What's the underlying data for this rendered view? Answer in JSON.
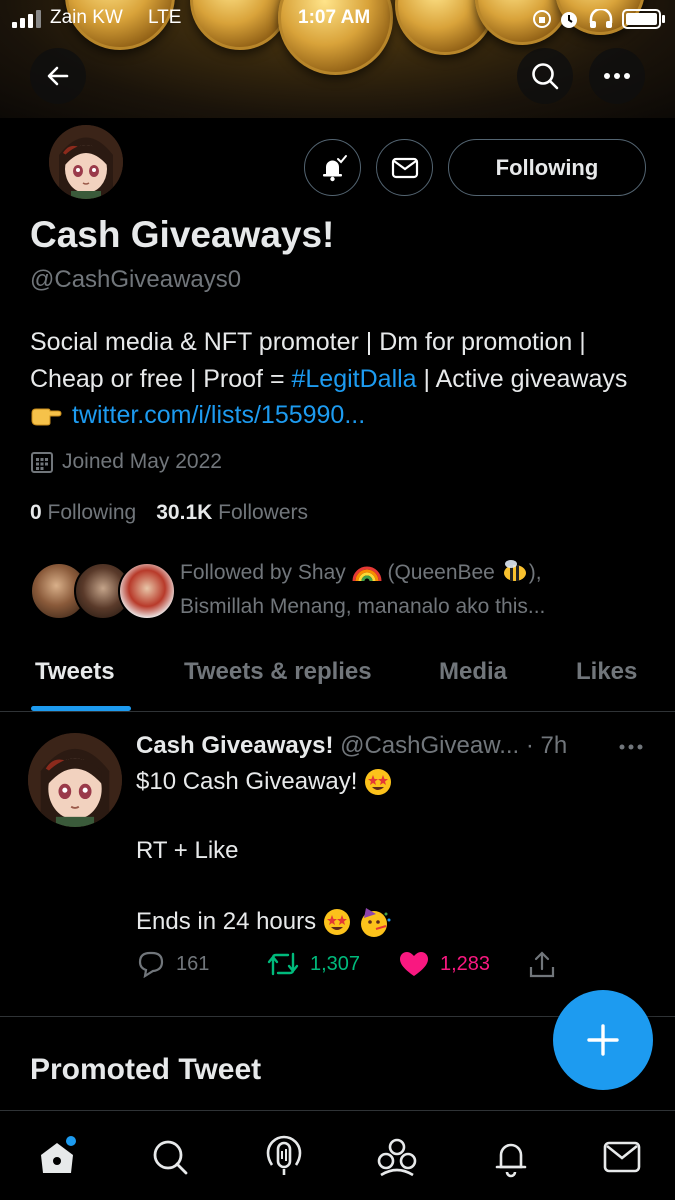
{
  "status_bar": {
    "carrier": "Zain KW",
    "network": "LTE",
    "time": "1:07 AM"
  },
  "header": {
    "back_icon": "arrow-left-icon",
    "search_icon": "search-icon",
    "more_icon": "more-dots-icon"
  },
  "profile": {
    "display_name": "Cash Giveaways!",
    "handle": "@CashGiveaways0",
    "bio_part1": "Social media & NFT promoter | Dm for promotion | Cheap or free | Proof = ",
    "bio_hashtag": "#LegitDalla",
    "bio_part2": " | Active giveaways ",
    "bio_link": "twitter.com/i/lists/155990...",
    "joined": "Joined May 2022",
    "following_count": "0",
    "following_label": "Following",
    "followers_count": "30.1K",
    "followers_label": "Followers",
    "followed_by_line1": "Followed by Shay",
    "followed_by_mid": "(QueenBee",
    "followed_by_end": "),",
    "followed_by_line2": "Bismillah Menang, mananalo ako this...",
    "follow_button": "Following"
  },
  "tabs": [
    {
      "label": "Tweets",
      "active": true
    },
    {
      "label": "Tweets & replies",
      "active": false
    },
    {
      "label": "Media",
      "active": false
    },
    {
      "label": "Likes",
      "active": false
    }
  ],
  "tweet": {
    "name": "Cash Giveaways!",
    "handle_time": "@CashGiveaw... · 7h",
    "line1": "$10 Cash Giveaway!",
    "line2": "RT + Like",
    "line3": "Ends in 24 hours",
    "replies": "161",
    "retweets": "1,307",
    "likes": "1,283",
    "colors": {
      "retweet": "#00ba7c",
      "like": "#f91880"
    }
  },
  "promoted_label": "Promoted Tweet",
  "bottom_nav": [
    "home-icon",
    "search-icon",
    "spaces-icon",
    "communities-icon",
    "notifications-icon",
    "messages-icon"
  ],
  "colors": {
    "accent": "#1d9bf0",
    "text_secondary": "#71767b"
  }
}
